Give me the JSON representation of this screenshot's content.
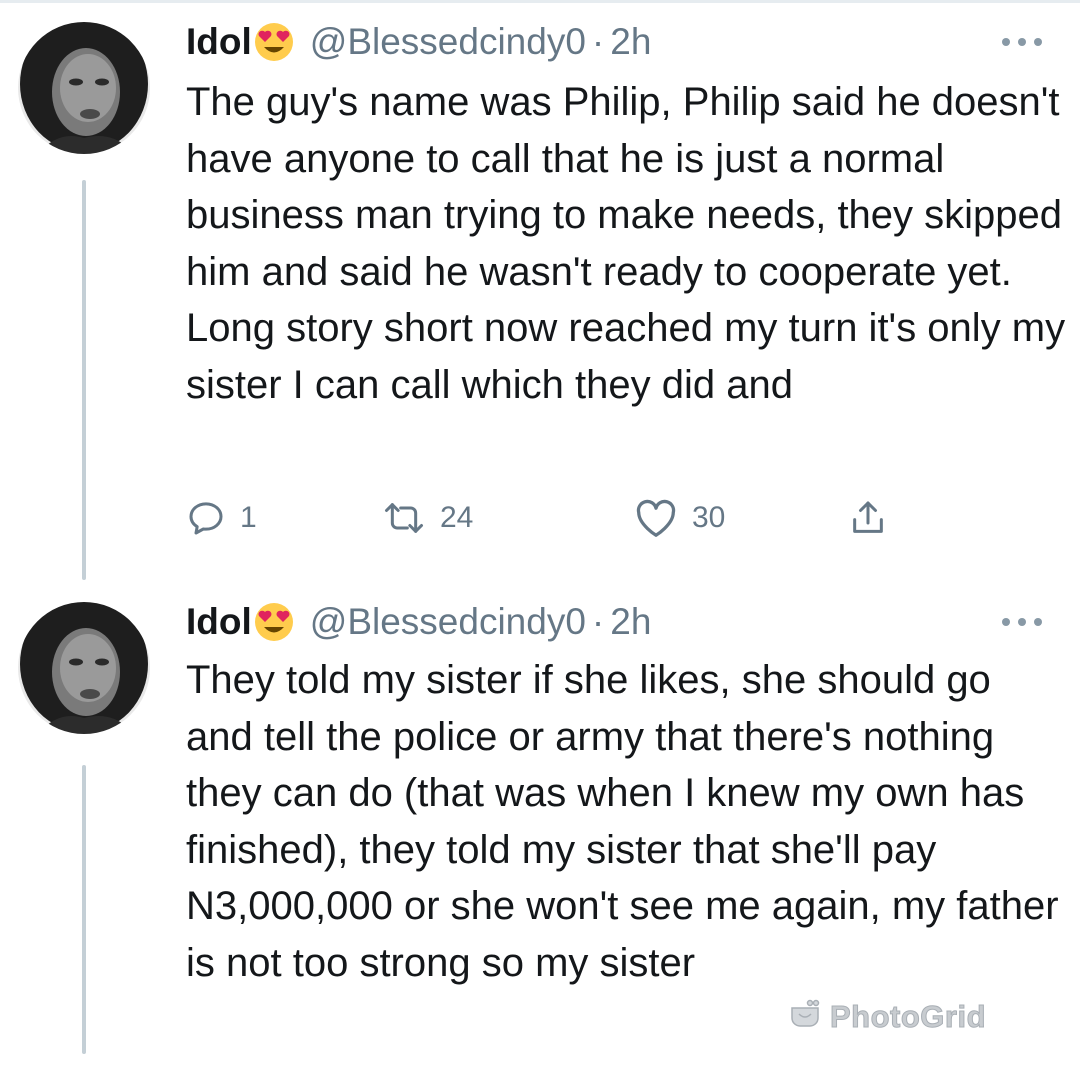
{
  "tweets": [
    {
      "display_name": "Idol",
      "emoji": "heart-eyes-emoji",
      "handle": "@Blessedcindy0",
      "separator": "·",
      "time": "2h",
      "text": "The guy's name was Philip, Philip said he doesn't have anyone to call that he is just a normal business man trying to make needs, they skipped him and said he wasn't ready to cooperate yet. Long story short now reached my turn it's only my sister I can call which they did and",
      "reply_count": "1",
      "retweet_count": "24",
      "like_count": "30"
    },
    {
      "display_name": "Idol",
      "emoji": "heart-eyes-emoji",
      "handle": "@Blessedcindy0",
      "separator": "·",
      "time": "2h",
      "text": "They told my sister if she likes, she should go and tell the police or army that there's nothing they can do (that was when I knew my own has finished), they told my sister that she'll pay N3,000,000 or she won't see me again, my father is not too strong so my sister"
    }
  ],
  "watermark": {
    "label": "PhotoGrid",
    "icon": "photogrid-logo-icon"
  },
  "icons": {
    "reply": "reply-icon",
    "retweet": "retweet-icon",
    "like": "like-icon",
    "share": "share-icon",
    "more": "more-options-icon"
  },
  "colors": {
    "text": "#14171a",
    "muted": "#657786",
    "thread_line": "#c4cfd6",
    "divider": "#e6ecf0",
    "emoji_face": "#ffcc4d",
    "emoji_hearts": "#e0245e"
  }
}
